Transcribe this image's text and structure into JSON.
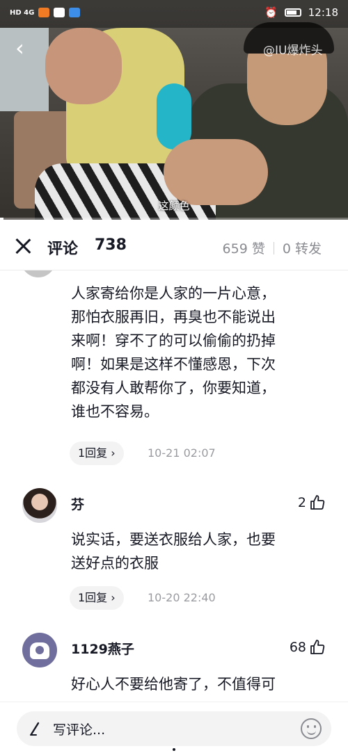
{
  "status_bar": {
    "network": "HD 4G",
    "time": "12:18"
  },
  "video": {
    "watermark": "@IU爆炸头",
    "subtitle": "这颜色",
    "progress_fraction": 0.01
  },
  "comments_header": {
    "title": "评论",
    "count": "738",
    "likes": "659 赞",
    "shares": "0 转发"
  },
  "comments": [
    {
      "body_lines": [
        "人家寄给你是人家的一片心意，",
        "那怕衣服再旧，再臭也不能说出",
        "来啊！穿不了的可以偷偷的扔掉",
        "啊！如果是这样不懂感恩，下次",
        "都没有人敢帮你了，你要知道，",
        "谁也不容易。"
      ],
      "replies": "1回复 ›",
      "time": "10-21 02:07"
    },
    {
      "user": "芬",
      "likes": "2",
      "body_lines": [
        "说实话，要送衣服给人家，也要",
        "送好点的衣服"
      ],
      "replies": "1回复 ›",
      "time": "10-20 22:40"
    },
    {
      "user": "1129燕子",
      "likes": "68",
      "body_lines": [
        "好心人不要给他寄了，不值得可"
      ]
    }
  ],
  "input_bar": {
    "placeholder": "写评论..."
  },
  "icons": {
    "back": "chevron-left-icon",
    "close": "close-icon",
    "like": "thumbs-up-icon",
    "pen": "pen-icon",
    "emoji": "emoji-icon"
  }
}
